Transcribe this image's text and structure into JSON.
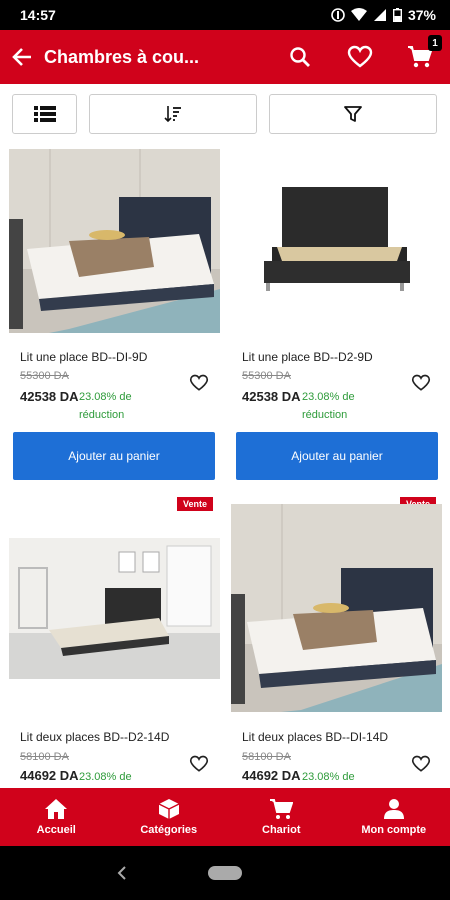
{
  "status": {
    "time": "14:57",
    "battery": "37%"
  },
  "header": {
    "title": "Chambres à cou...",
    "cart_count": "1"
  },
  "products": [
    {
      "name": "Lit une place BD--DI-9D",
      "old_price": "55300 DA",
      "price": "42538 DA",
      "discount": "23.08% de réduction",
      "button": "Ajouter au panier",
      "badge": ""
    },
    {
      "name": "Lit une place BD--D2-9D",
      "old_price": "55300 DA",
      "price": "42538 DA",
      "discount": "23.08% de réduction",
      "button": "Ajouter au panier",
      "badge": ""
    },
    {
      "name": "Lit deux places BD--D2-14D",
      "old_price": "58100 DA",
      "price": "44692 DA",
      "discount": "23.08% de",
      "button": "",
      "badge": "Vente"
    },
    {
      "name": "Lit deux places BD--DI-14D",
      "old_price": "58100 DA",
      "price": "44692 DA",
      "discount": "23.08% de",
      "button": "",
      "badge": "Vente"
    }
  ],
  "bottom_nav": [
    {
      "label": "Accueil",
      "icon": "home-icon"
    },
    {
      "label": "Catégories",
      "icon": "categories-icon"
    },
    {
      "label": "Chariot",
      "icon": "cart-icon"
    },
    {
      "label": "Mon compte",
      "icon": "account-icon"
    }
  ]
}
